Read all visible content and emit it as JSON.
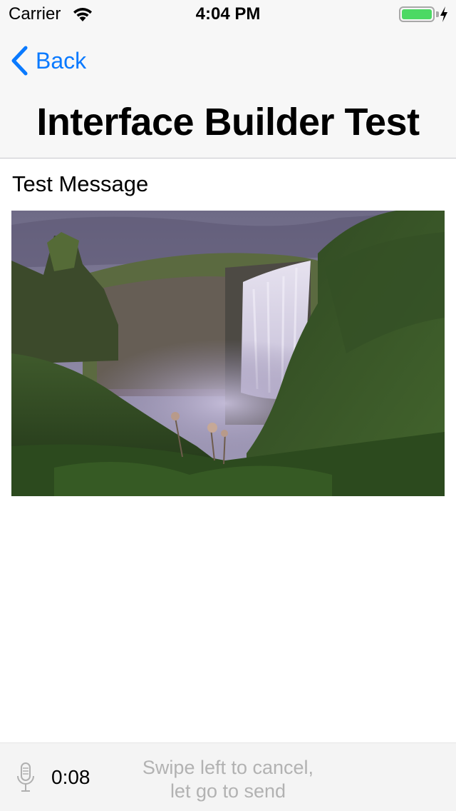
{
  "status_bar": {
    "carrier": "Carrier",
    "time": "4:04 PM",
    "wifi_icon": "wifi-icon",
    "battery_icon": "battery-icon",
    "battery_level": 1.0,
    "battery_color": "#4cd964",
    "charging_icon": "bolt-icon"
  },
  "nav": {
    "back_label": "Back",
    "back_icon": "chevron-left-icon",
    "title": "Interface Builder Test",
    "tint_color": "#0a7aff"
  },
  "content": {
    "message": "Test Message",
    "image_subject": "waterfall-photo"
  },
  "recorder": {
    "mic_icon": "microphone-icon",
    "elapsed": "0:08",
    "hint_line1": "Swipe left to cancel,",
    "hint_line2": "let go to send"
  }
}
